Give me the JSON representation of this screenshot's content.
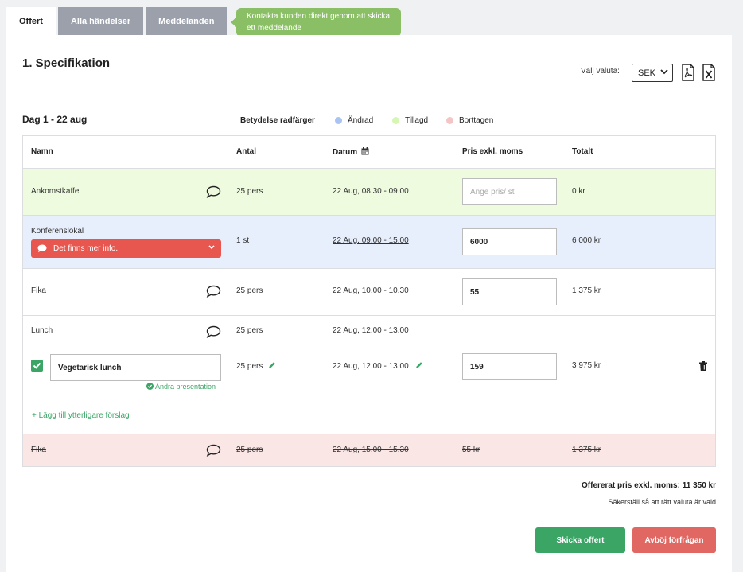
{
  "tabs": [
    "Offert",
    "Alla händelser",
    "Meddelanden"
  ],
  "tooltip": "Kontakta kunden direkt genom att skicka ett meddelande",
  "section_title": "1. Specifikation",
  "currency": {
    "label": "Välj valuta:",
    "value": "SEK"
  },
  "day_title": "Dag 1 - 22 aug",
  "legend": {
    "title": "Betydelse radfärger",
    "items": [
      {
        "label": "Ändrad",
        "color": "#a9c4f2"
      },
      {
        "label": "Tillagd",
        "color": "#d6f7b3"
      },
      {
        "label": "Borttagen",
        "color": "#f5c5c5"
      }
    ]
  },
  "columns": {
    "name": "Namn",
    "qty": "Antal",
    "date": "Datum",
    "price": "Pris exkl. moms",
    "total": "Totalt"
  },
  "rows": {
    "r1": {
      "name": "Ankomstkaffe",
      "qty": "25 pers",
      "date": "22 Aug, 08.30 - 09.00",
      "price_placeholder": "Ange pris/ st",
      "total": "0 kr"
    },
    "r2": {
      "name": "Konferenslokal",
      "dropdown": "Det finns mer info.",
      "qty": "1 st",
      "date": "22 Aug, 09.00 - 15.00",
      "price": "6000",
      "total": "6 000 kr"
    },
    "r3": {
      "name": "Fika",
      "qty": "25 pers",
      "date": "22 Aug, 10.00 - 10.30",
      "price": "55",
      "total": "1 375 kr"
    },
    "r4": {
      "name": "Lunch",
      "qty": "25 pers",
      "date": "22 Aug, 12.00 - 13.00",
      "option": "Vegetarisk lunch",
      "option_qty": "25 pers",
      "option_date": "22 Aug, 12.00 - 13.00",
      "option_price": "159",
      "option_total": "3 975 kr",
      "change_link": "Ändra presentation",
      "add_link": "+ Lägg till ytterligare förslag"
    },
    "r5": {
      "name": "Fika",
      "qty": "25 pers",
      "date": "22 Aug, 15.00 - 15.30",
      "price": "55 kr",
      "total": "1 375 kr"
    }
  },
  "total": "Offererat pris exkl. moms: 11 350 kr",
  "note": "Säkerställ så att rätt valuta är vald",
  "buttons": {
    "send": "Skicka offert",
    "decline": "Avböj förfrågan"
  },
  "colors": {
    "changed_row": "#e8effc",
    "added_row": "#eefbdf",
    "removed_row": "#fbe6e6",
    "green": "#3aa565",
    "red": "#e16762",
    "tooltip": "#8bbf66"
  }
}
